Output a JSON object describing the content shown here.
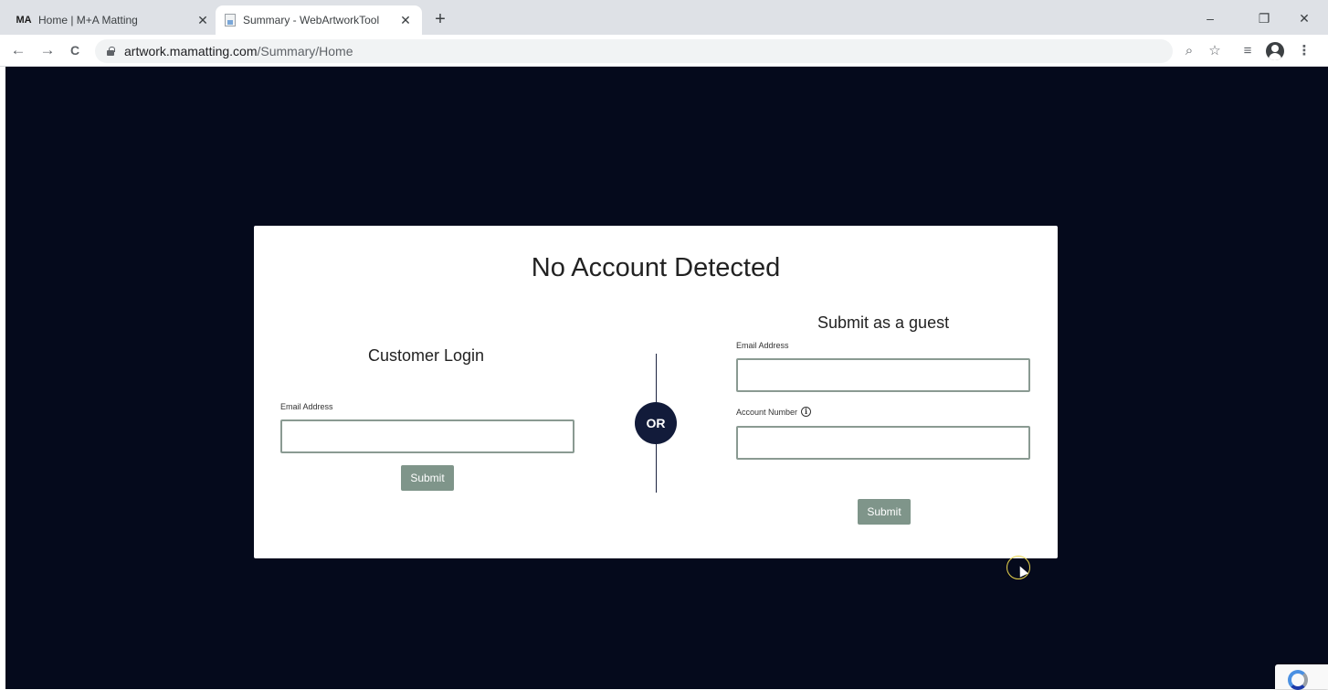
{
  "browser": {
    "tabs": [
      {
        "title": "Home | M+A Matting",
        "favicon": "MA",
        "active": false
      },
      {
        "title": "Summary - WebArtworkTool",
        "active": true
      }
    ],
    "new_tab_label": "+",
    "url_host": "artwork.mamatting.com",
    "url_path": "/Summary/Home",
    "icons": {
      "back": "←",
      "forward": "→",
      "reload": "C",
      "zoom": "⌕",
      "star": "☆",
      "reading_list": "≡",
      "menu": "⋮",
      "minimize": "–",
      "restore": "❐",
      "close": "✕",
      "tab_close": "✕"
    }
  },
  "modal": {
    "title": "No Account Detected",
    "login": {
      "heading": "Customer Login",
      "email_label": "Email Address",
      "email_value": "",
      "submit_label": "Submit"
    },
    "divider": {
      "label": "OR"
    },
    "guest": {
      "heading": "Submit as a guest",
      "email_label": "Email Address",
      "email_value": "",
      "account_label": "Account Number",
      "account_info_icon": "i",
      "account_value": "",
      "submit_label": "Submit"
    }
  },
  "colors": {
    "page_background": "#050a1c",
    "button": "#7f958a",
    "input_border": "#8a9a92",
    "or_badge": "#121b3a"
  }
}
